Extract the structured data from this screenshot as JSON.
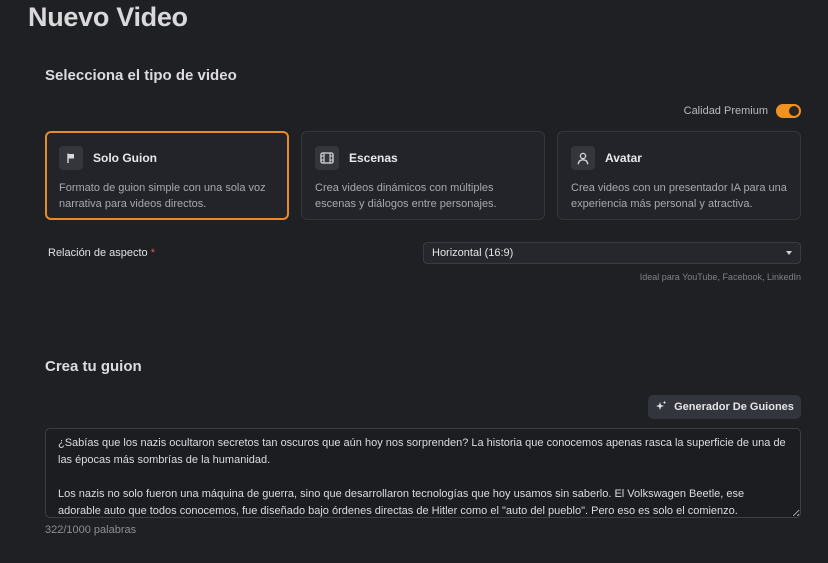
{
  "page_title": "Nuevo Video",
  "video_type_section": {
    "title": "Selecciona el tipo de video",
    "premium_label": "Calidad Premium",
    "premium_enabled": true,
    "cards": [
      {
        "title": "Solo Guion",
        "description": "Formato de guion simple con una sola voz narrativa para videos directos.",
        "icon": "flag-icon",
        "selected": true
      },
      {
        "title": "Escenas",
        "description": "Crea videos dinámicos con múltiples escenas y diálogos entre personajes.",
        "icon": "film-icon",
        "selected": false
      },
      {
        "title": "Avatar",
        "description": "Crea videos con un presentador IA para una experiencia más personal y atractiva.",
        "icon": "user-icon",
        "selected": false
      }
    ],
    "aspect_label": "Relación de aspecto",
    "aspect_required": "*",
    "aspect_value": "Horizontal (16:9)",
    "aspect_hint": "Ideal para YouTube, Facebook, LinkedIn"
  },
  "script_section": {
    "title": "Crea tu guion",
    "generator_button": "Generador De Guiones",
    "script_text": "¿Sabías que los nazis ocultaron secretos tan oscuros que aún hoy nos sorprenden? La historia que conocemos apenas rasca la superficie de una de las épocas más sombrías de la humanidad.\n\nLos nazis no solo fueron una máquina de guerra, sino que desarrollaron tecnologías que hoy usamos sin saberlo. El Volkswagen Beetle, ese adorable auto que todos conocemos, fue diseñado bajo órdenes directas de Hitler como el \"auto del pueblo\". Pero eso es solo el comienzo.",
    "word_count": "322/1000 palabras"
  },
  "colors": {
    "accent": "#e8892b",
    "background": "#1f2024"
  }
}
